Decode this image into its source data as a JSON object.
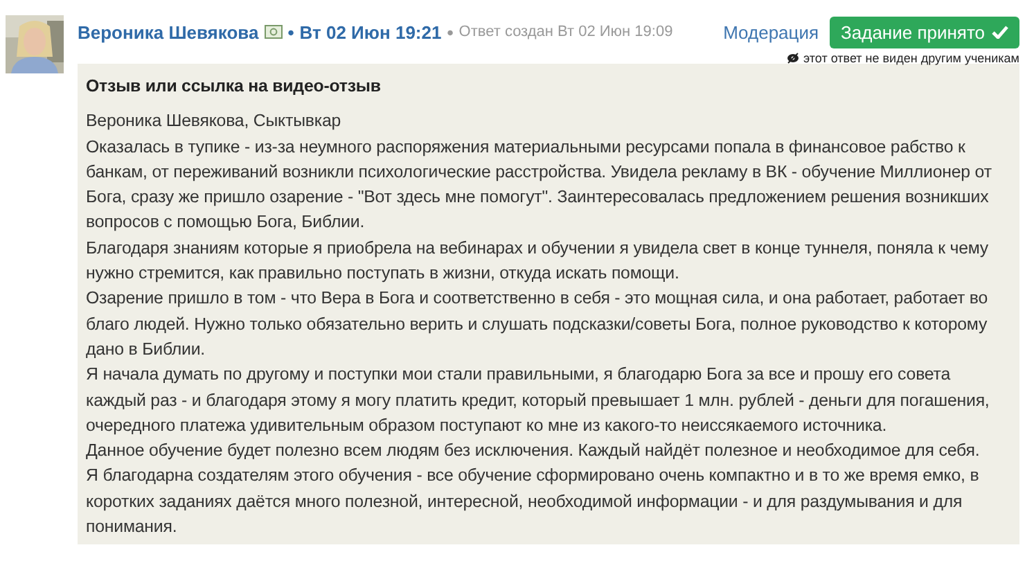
{
  "author": {
    "name": "Вероника Шевякова",
    "separator": "•",
    "date": "Вт 02 Июн 19:21",
    "created": "Ответ создан Вт 02 Июн 19:09"
  },
  "moderation_link": "Модерация",
  "status": {
    "label": "Задание принято",
    "accepted": true
  },
  "visibility_note": "этот ответ не виден другим ученикам",
  "answer": {
    "title": "Отзыв или ссылка на видео-отзыв",
    "paragraphs": [
      "Вероника Шевякова, Сыктывкар",
      "Оказалась в тупике - из-за неумного распоряжения материальными ресурсами попала в финансовое рабство к банкам, от переживаний возникли психологические расстройства. Увидела рекламу в ВК - обучение Миллионер от Бога, сразу же пришло озарение - \"Вот здесь мне помогут\". Заинтересовалась предложением решения возникших вопросов с помощью Бога, Библии.",
      "Благодаря знаниям которые я приобрела на вебинарах и обучении я увидела свет в конце туннеля, поняла к чему нужно стремится, как правильно поступать в жизни, откуда искать помощи.",
      "Озарение пришло в том - что Вера в Бога и соответственно в себя - это мощная сила, и она работает, работает во благо людей. Нужно только обязательно верить и слушать подсказки/советы Бога, полное руководство к которому дано в Библии.",
      "Я начала думать по другому и поступки мои стали правильными, я благодарю Бога за все и прошу его совета каждый раз - и благодаря этому я могу платить кредит, который превышает 1 млн. рублей - деньги для погашения, очередного платежа удивительным образом поступают ко мне из какого-то неиссякаемого источника.",
      "Данное обучение будет полезно всем людям без исключения. Каждый найдёт полезное и необходимое для себя.",
      "Я благодарна создателям этого обучения - все обучение сформировано очень компактно и в то же время емко, в коротких заданиях даётся много полезной, интересной, необходимой информации - и для раздумывания и для понимания."
    ]
  }
}
